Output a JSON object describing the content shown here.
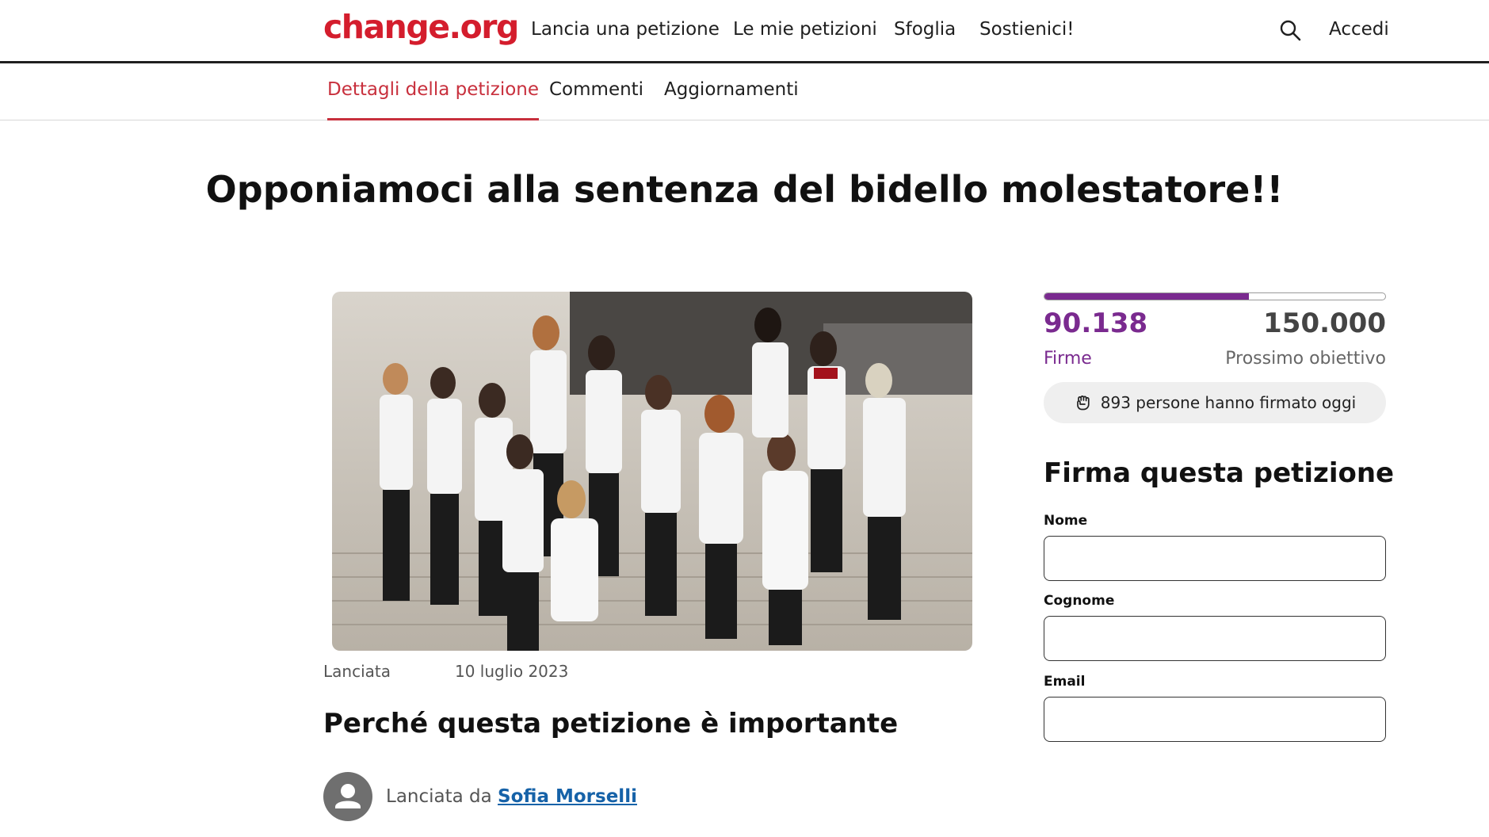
{
  "header": {
    "logo": "change.org",
    "nav": [
      "Lancia una petizione",
      "Le mie petizioni",
      "Sfoglia",
      "Sostienici!"
    ],
    "signin": "Accedi",
    "search_icon": "search-icon"
  },
  "tabs": [
    "Dettagli della petizione",
    "Commenti",
    "Aggiornamenti"
  ],
  "petition": {
    "title": "Opponiamoci alla sentenza del bidello molestatore!!",
    "launched_label": "Lanciata",
    "launched_date": "10 luglio 2023",
    "section_heading": "Perché questa petizione è importante",
    "started_by_prefix": "Lanciata da ",
    "author": "Sofia Morselli"
  },
  "signatures": {
    "count": "90.138",
    "goal": "150.000",
    "count_label": "Firme",
    "goal_label": "Prossimo obiettivo",
    "progress_fraction": 0.601,
    "today_text": "893 persone hanno firmato oggi"
  },
  "form": {
    "heading": "Firma questa petizione",
    "first_name_label": "Nome",
    "last_name_label": "Cognome",
    "email_label": "Email",
    "first_name_value": "",
    "last_name_value": "",
    "email_value": ""
  },
  "colors": {
    "brand": "#d41d2d",
    "accent": "#7a2a8f",
    "link": "#1662a8",
    "active_tab": "#c8303d"
  }
}
